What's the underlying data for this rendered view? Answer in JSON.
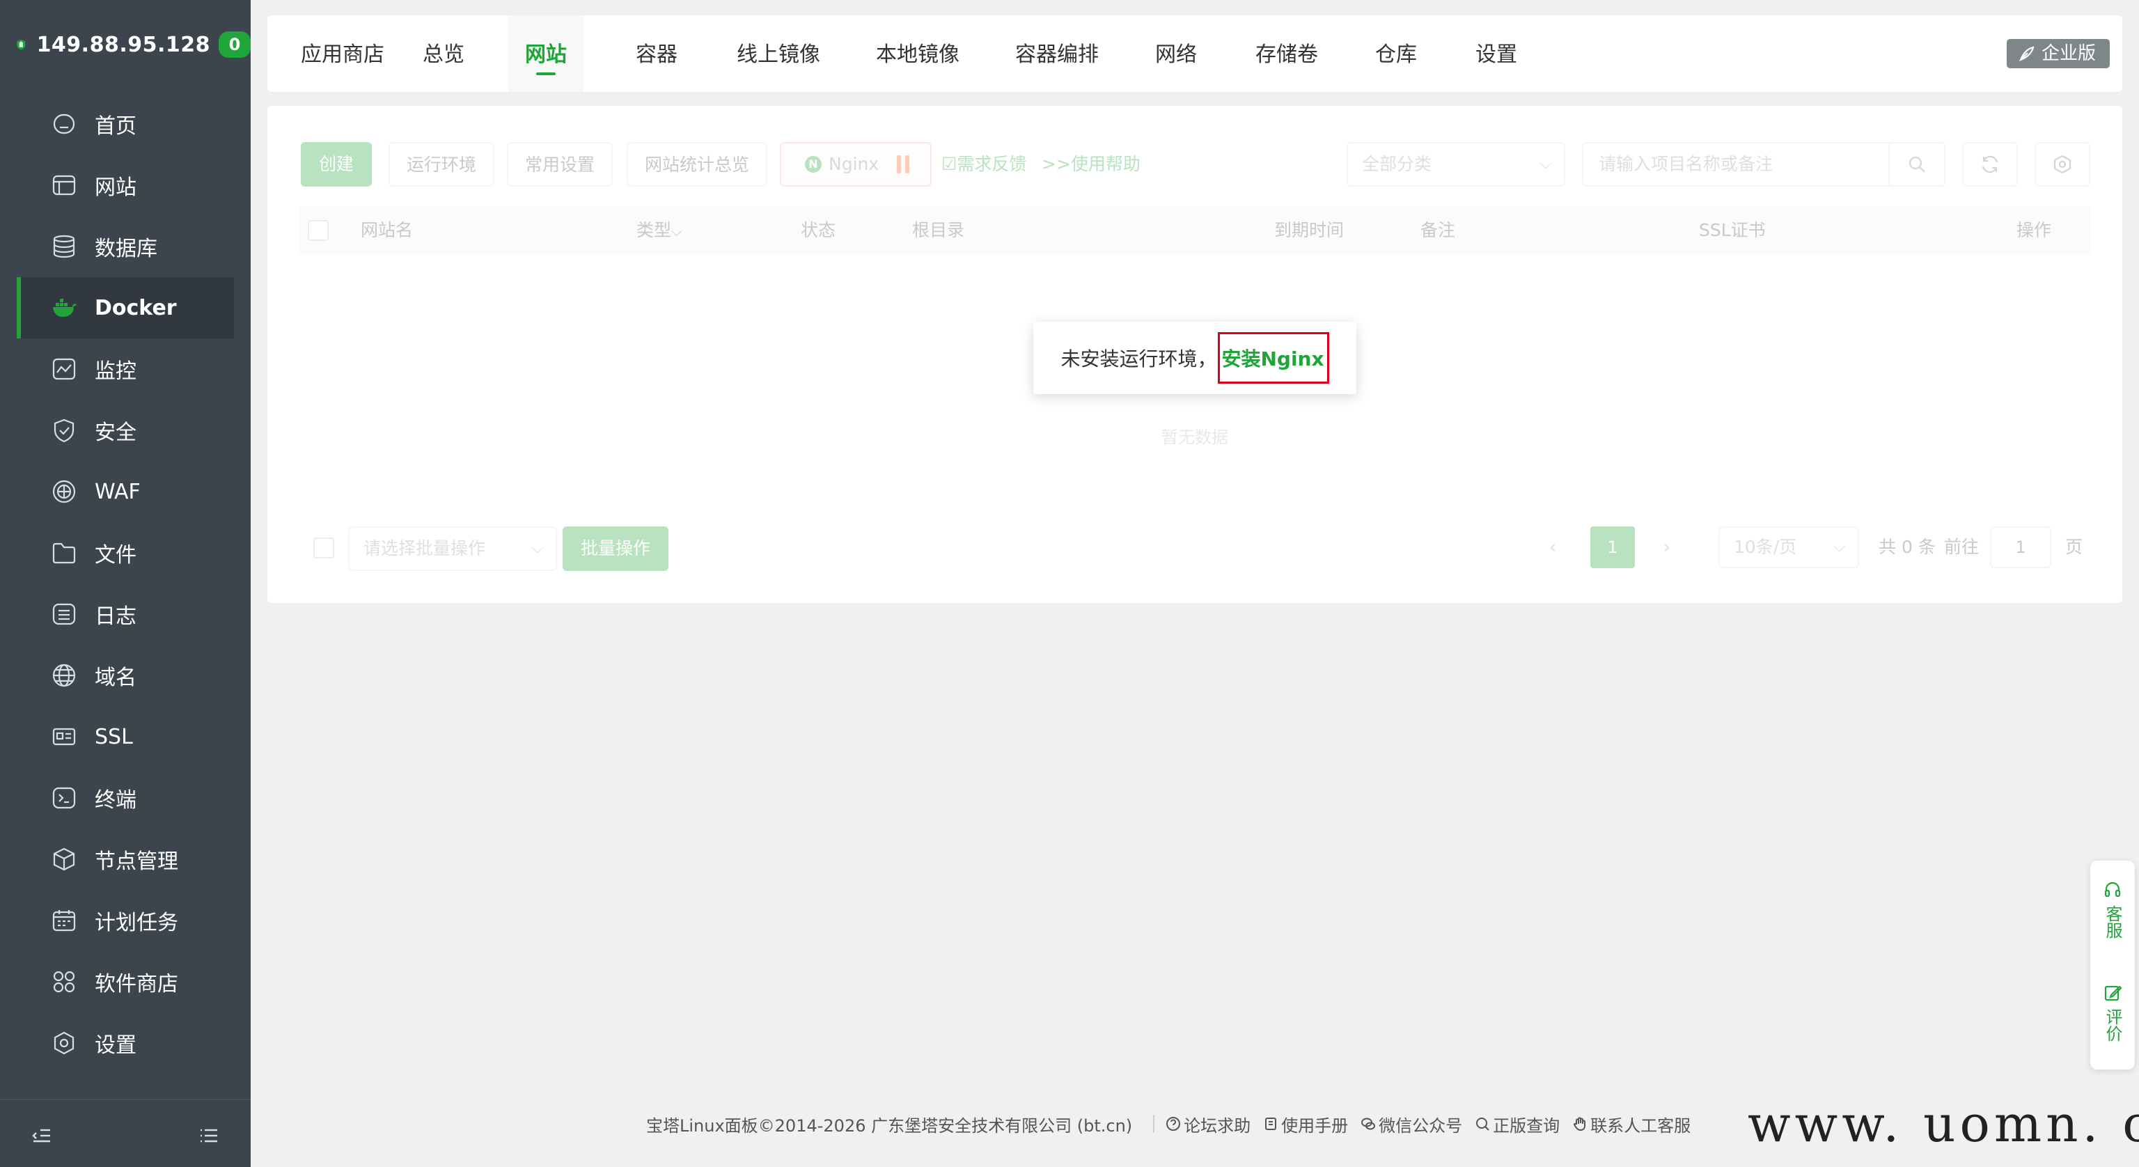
{
  "sidebar": {
    "server_ip": "149.88.95.128",
    "badge_count": "0",
    "items": [
      {
        "label": "首页",
        "icon": "home-icon"
      },
      {
        "label": "网站",
        "icon": "website-icon"
      },
      {
        "label": "数据库",
        "icon": "database-icon"
      },
      {
        "label": "Docker",
        "icon": "docker-icon",
        "active": true
      },
      {
        "label": "监控",
        "icon": "monitor-icon"
      },
      {
        "label": "安全",
        "icon": "shield-icon"
      },
      {
        "label": "WAF",
        "icon": "waf-icon"
      },
      {
        "label": "文件",
        "icon": "folder-icon"
      },
      {
        "label": "日志",
        "icon": "log-icon"
      },
      {
        "label": "域名",
        "icon": "globe-icon"
      },
      {
        "label": "SSL",
        "icon": "ssl-icon"
      },
      {
        "label": "终端",
        "icon": "terminal-icon"
      },
      {
        "label": "节点管理",
        "icon": "node-icon"
      },
      {
        "label": "计划任务",
        "icon": "calendar-icon"
      },
      {
        "label": "软件商店",
        "icon": "apps-icon"
      },
      {
        "label": "设置",
        "icon": "settings-icon"
      }
    ]
  },
  "tabs": {
    "items": [
      "应用商店",
      "总览",
      "网站",
      "容器",
      "线上镜像",
      "本地镜像",
      "容器编排",
      "网络",
      "存储卷",
      "仓库",
      "设置"
    ],
    "active": "网站",
    "enterprise_label": "企业版"
  },
  "toolbar": {
    "create": "创建",
    "runtime": "运行环境",
    "common_settings": "常用设置",
    "site_stats": "网站统计总览",
    "nginx": "Nginx",
    "feedback": "需求反馈",
    "help": ">>使用帮助",
    "category_select": "全部分类",
    "search_placeholder": "请输入项目名称或备注"
  },
  "table": {
    "headers": {
      "name": "网站名",
      "type": "类型",
      "status": "状态",
      "root": "根目录",
      "expire": "到期时间",
      "remark": "备注",
      "ssl": "SSL证书",
      "action": "操作"
    },
    "type_sort_glyph": "⌵",
    "empty_text": "暂无数据",
    "notice_text": "未安装运行环境，",
    "install_link": "安装Nginx"
  },
  "batch": {
    "select_placeholder": "请选择批量操作",
    "button": "批量操作"
  },
  "pager": {
    "prev": "‹",
    "next": "›",
    "current": "1",
    "page_size": "10条/页",
    "total": "共 0 条",
    "goto": "前往",
    "goto_value": "1",
    "page_unit": "页"
  },
  "float": {
    "support": "客服",
    "review": "评价"
  },
  "footer": {
    "copyright": "宝塔Linux面板©2014-2026 广东堡塔安全技术有限公司 (bt.cn)",
    "forum": "论坛求助",
    "manual": "使用手册",
    "wechat": "微信公众号",
    "genuine": "正版查询",
    "contact": "联系人工客服"
  },
  "watermark": "www. uomn. cn",
  "colors": {
    "accent": "#20a53a",
    "sidebar_bg": "#3c444d",
    "highlight_box": "#e0001a"
  }
}
